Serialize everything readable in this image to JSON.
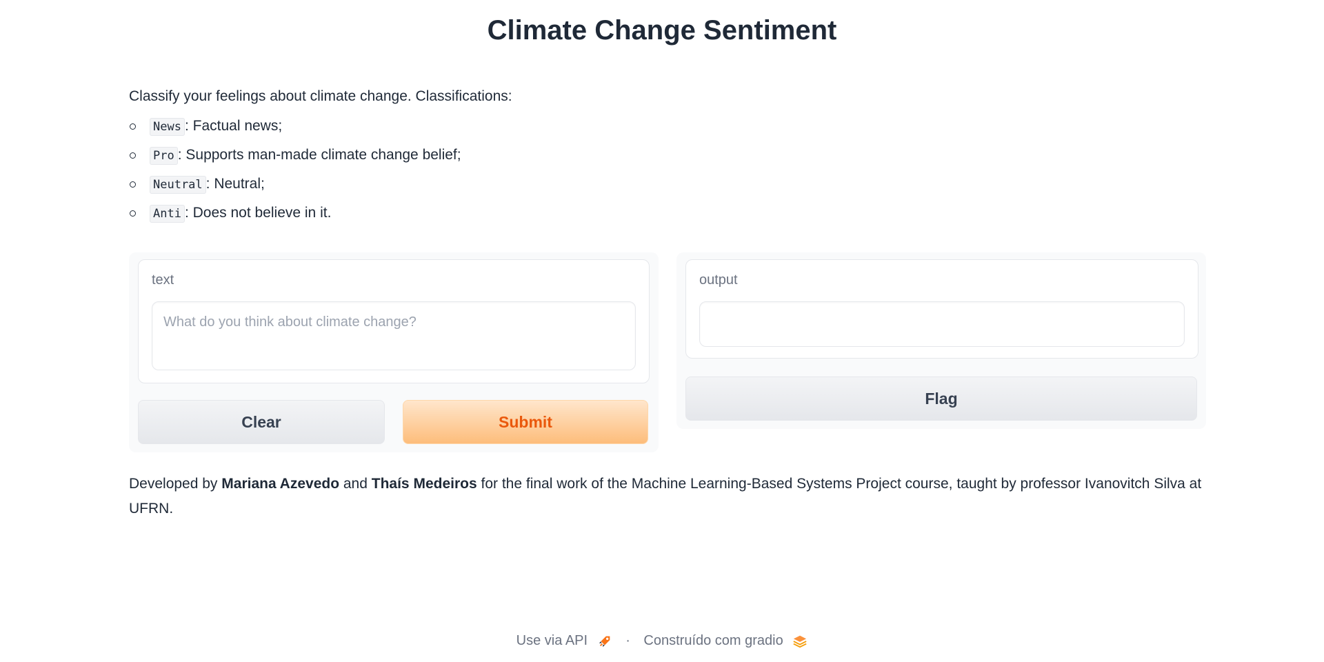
{
  "title": "Climate Change Sentiment",
  "description": {
    "intro": "Classify your feelings about climate change. Classifications:",
    "items": [
      {
        "code": "News",
        "text": ": Factual news;"
      },
      {
        "code": "Pro",
        "text": ": Supports man-made climate change belief;"
      },
      {
        "code": "Neutral",
        "text": ": Neutral;"
      },
      {
        "code": "Anti",
        "text": ": Does not believe in it."
      }
    ]
  },
  "input_panel": {
    "label": "text",
    "placeholder": "What do you think about climate change?",
    "value": "",
    "clear_label": "Clear",
    "submit_label": "Submit"
  },
  "output_panel": {
    "label": "output",
    "value": "",
    "flag_label": "Flag"
  },
  "credits": {
    "prefix": "Developed by ",
    "author1": "Mariana Azevedo",
    "and": " and ",
    "author2": "Thaís Medeiros",
    "suffix": " for the final work of the Machine Learning-Based Systems Project course, taught by professor Ivanovitch Silva at UFRN."
  },
  "footer": {
    "api_label": "Use via API",
    "separator": "·",
    "built_with": "Construído com gradio"
  },
  "colors": {
    "accent": "#ea580c",
    "primary_gradient_start": "#ffe6cc",
    "primary_gradient_end": "#fdbd7b"
  },
  "icons": {
    "api": "rocket-icon",
    "gradio": "gradio-logo-icon"
  }
}
